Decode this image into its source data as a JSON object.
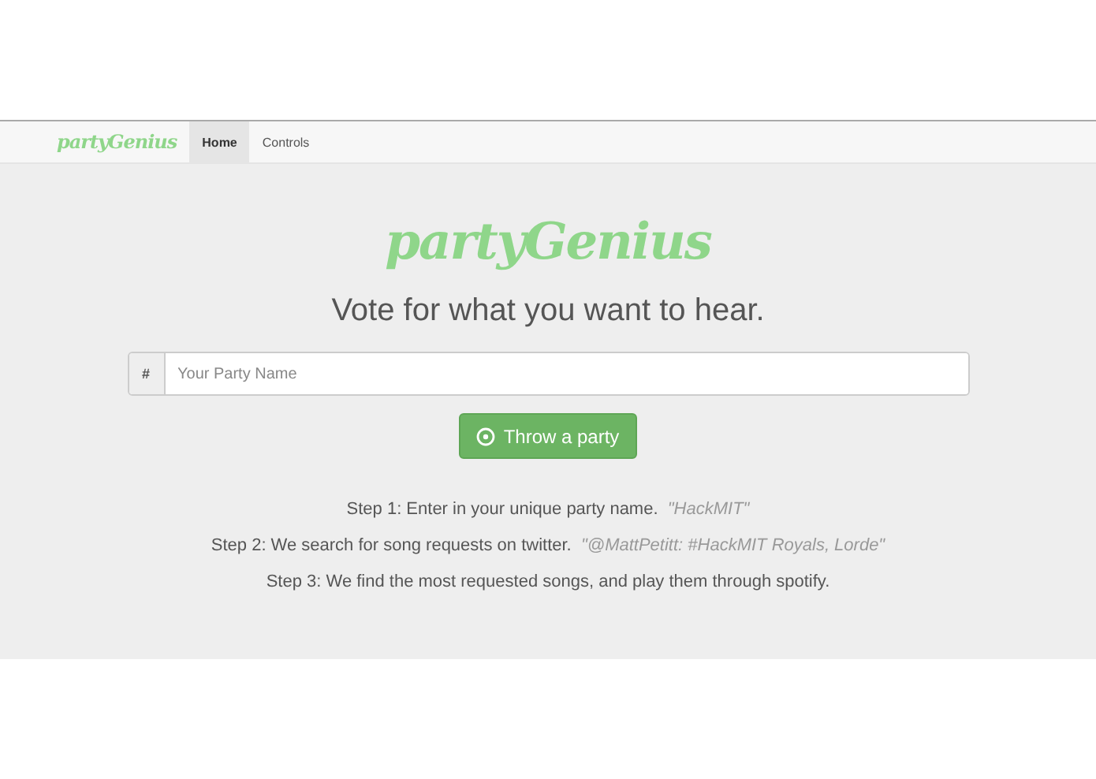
{
  "navbar": {
    "brand": "partyGenius",
    "items": [
      {
        "label": "Home",
        "selected": true
      },
      {
        "label": "Controls",
        "selected": false
      }
    ]
  },
  "hero": {
    "logo": "partyGenius",
    "tagline": "Vote for what you want to hear.",
    "input_addon": "#",
    "input_placeholder": "Your Party Name",
    "button": "Throw a party"
  },
  "steps": [
    {
      "text": "Step 1: Enter in your unique party name.",
      "example": "\"HackMIT\""
    },
    {
      "text": "Step 2: We search for song requests on twitter.",
      "example": "\"@MattPetitt: #HackMIT Royals, Lorde\""
    },
    {
      "text": "Step 3: We find the most requested songs, and play them through spotify."
    }
  ]
}
